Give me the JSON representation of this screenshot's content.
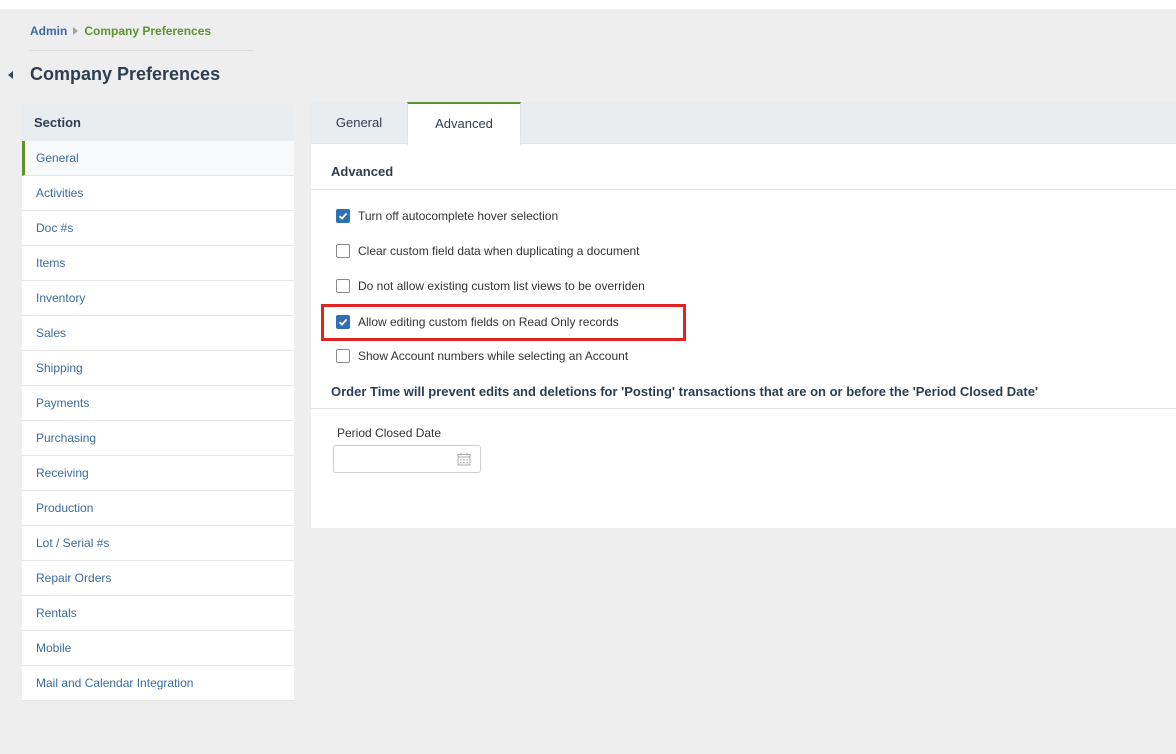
{
  "breadcrumb": {
    "root": "Admin",
    "current": "Company Preferences"
  },
  "page": {
    "title": "Company Preferences"
  },
  "sidebar": {
    "header": "Section",
    "items": [
      {
        "label": "General",
        "active": true
      },
      {
        "label": "Activities"
      },
      {
        "label": "Doc #s"
      },
      {
        "label": "Items"
      },
      {
        "label": "Inventory"
      },
      {
        "label": "Sales"
      },
      {
        "label": "Shipping"
      },
      {
        "label": "Payments"
      },
      {
        "label": "Purchasing"
      },
      {
        "label": "Receiving"
      },
      {
        "label": "Production"
      },
      {
        "label": "Lot / Serial #s"
      },
      {
        "label": "Repair Orders"
      },
      {
        "label": "Rentals"
      },
      {
        "label": "Mobile"
      },
      {
        "label": "Mail and Calendar Integration"
      }
    ]
  },
  "tabs": [
    {
      "label": "General",
      "active": false
    },
    {
      "label": "Advanced",
      "active": true
    }
  ],
  "advanced": {
    "section_title": "Advanced",
    "options": [
      {
        "label": "Turn off autocomplete hover selection",
        "checked": true
      },
      {
        "label": "Clear custom field data when duplicating a document",
        "checked": false
      },
      {
        "label": "Do not allow existing custom list views to be overriden",
        "checked": false
      },
      {
        "label": "Allow editing custom fields on Read Only records",
        "checked": true
      },
      {
        "label": "Show Account numbers while selecting an Account",
        "checked": false
      }
    ],
    "notice": "Order Time will prevent edits and deletions for 'Posting' transactions that are on or before the 'Period Closed Date'",
    "period_closed_date": {
      "label": "Period Closed Date",
      "value": ""
    }
  },
  "colors": {
    "accent": "#5d9432",
    "link": "#3b6b9e",
    "checkbox": "#2f6fb5",
    "highlight": "#e02424"
  },
  "icons": {
    "calendar": "calendar-icon",
    "check": "check-icon",
    "collapse": "collapse-left-icon"
  }
}
